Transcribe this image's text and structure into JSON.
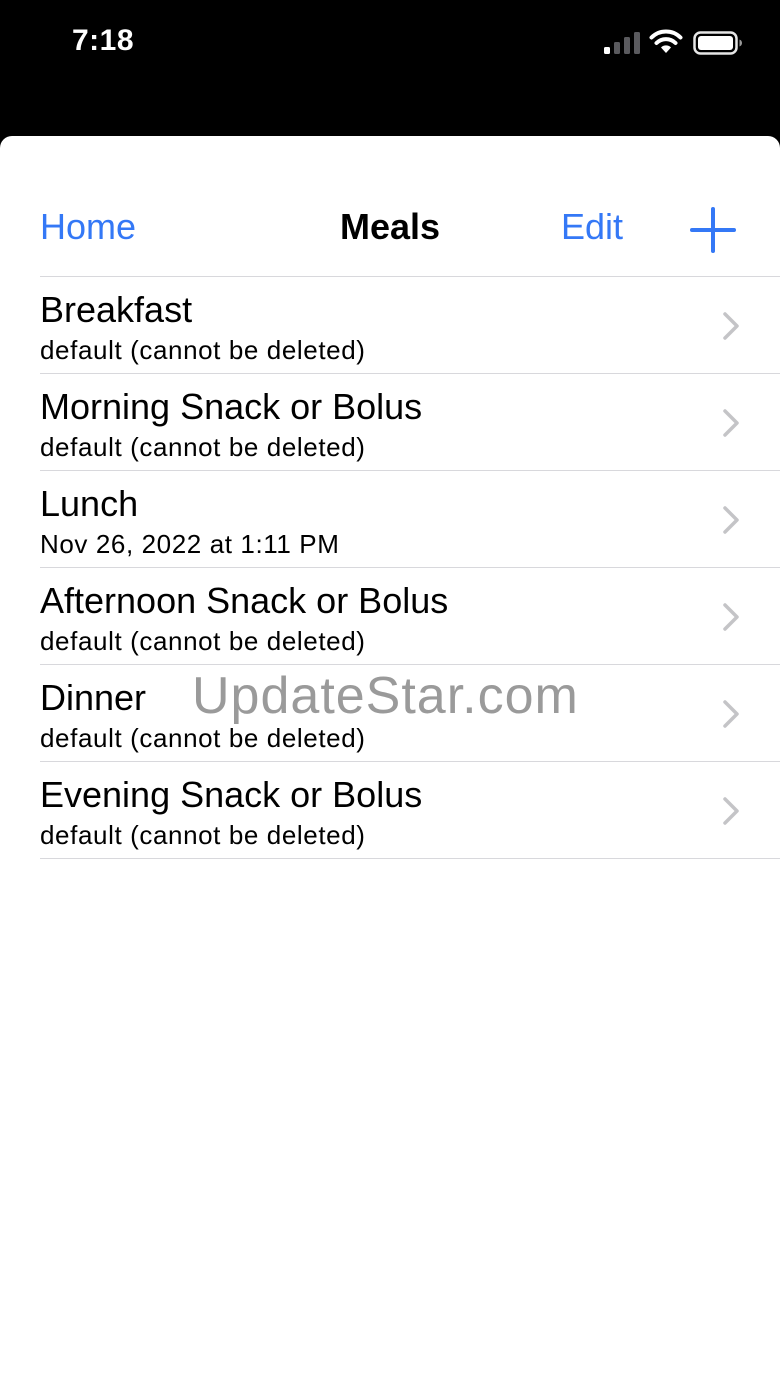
{
  "status_bar": {
    "time": "7:18",
    "icons": [
      "signal-icon",
      "wifi-icon",
      "battery-icon"
    ]
  },
  "nav": {
    "back_label": "Home",
    "title": "Meals",
    "edit_label": "Edit",
    "add_icon": "plus-icon"
  },
  "meals": [
    {
      "title": "Breakfast",
      "subtitle": "default (cannot be deleted)"
    },
    {
      "title": "Morning Snack or Bolus",
      "subtitle": "default (cannot be deleted)"
    },
    {
      "title": "Lunch",
      "subtitle": "Nov 26, 2022 at 1:11 PM"
    },
    {
      "title": "Afternoon Snack or Bolus",
      "subtitle": "default (cannot be deleted)"
    },
    {
      "title": "Dinner",
      "subtitle": "default (cannot be deleted)"
    },
    {
      "title": "Evening Snack or Bolus",
      "subtitle": "default (cannot be deleted)"
    }
  ],
  "watermark": "UpdateStar.com",
  "colors": {
    "accent": "#3478f6",
    "separator": "#d8d8dc",
    "chevron": "#c4c4c7"
  }
}
